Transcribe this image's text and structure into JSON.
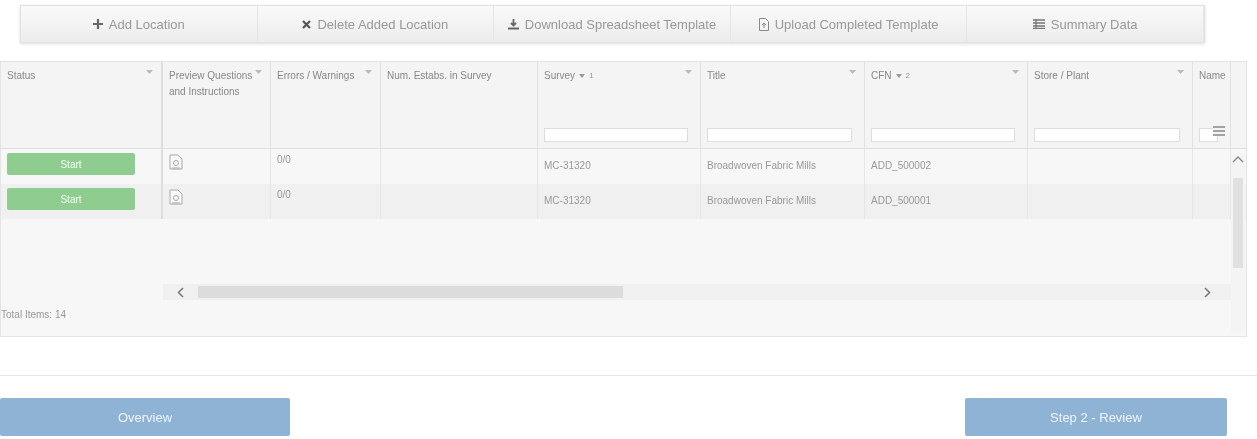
{
  "toolbar": [
    {
      "label": "Add Location",
      "kind": "plus"
    },
    {
      "label": "Delete Added Location",
      "kind": "x"
    },
    {
      "label": "Download Spreadsheet Template",
      "kind": "download"
    },
    {
      "label": "Upload Completed Template",
      "kind": "upload"
    },
    {
      "label": "Summary Data",
      "kind": "list"
    }
  ],
  "grid": {
    "columns": [
      {
        "label": "Status",
        "kind": "status",
        "menu": true,
        "filter": false
      },
      {
        "label": "Preview Questions and Instructions",
        "kind": "preview",
        "menu": true,
        "filter": false
      },
      {
        "label": "Errors / Warnings",
        "kind": "text",
        "menu": true,
        "filter": false
      },
      {
        "label": "Num. Estabs. in Survey",
        "kind": "text",
        "menu": false,
        "filter": false
      },
      {
        "label": "Survey",
        "sort": "1",
        "kind": "text",
        "menu": true,
        "filter": true
      },
      {
        "label": "Title",
        "kind": "text",
        "menu": true,
        "filter": true
      },
      {
        "label": "CFN",
        "sort": "2",
        "kind": "text",
        "menu": true,
        "filter": true
      },
      {
        "label": "Store / Plant",
        "kind": "text",
        "menu": true,
        "filter": true
      },
      {
        "label": "Name",
        "kind": "text",
        "menu": false,
        "filter": true
      }
    ],
    "rows": [
      {
        "cells": [
          "Start",
          null,
          "0/0",
          null,
          "MC-31320",
          "Broadwoven Fabric Mills",
          "ADD_500002",
          null,
          null
        ]
      },
      {
        "cells": [
          "Start",
          null,
          "0/0",
          null,
          "MC-31320",
          "Broadwoven Fabric Mills",
          "ADD_500001",
          null,
          null
        ]
      }
    ],
    "total": "Total Items: 14"
  },
  "footer": {
    "back": "Overview",
    "next": "Step 2 - Review"
  }
}
